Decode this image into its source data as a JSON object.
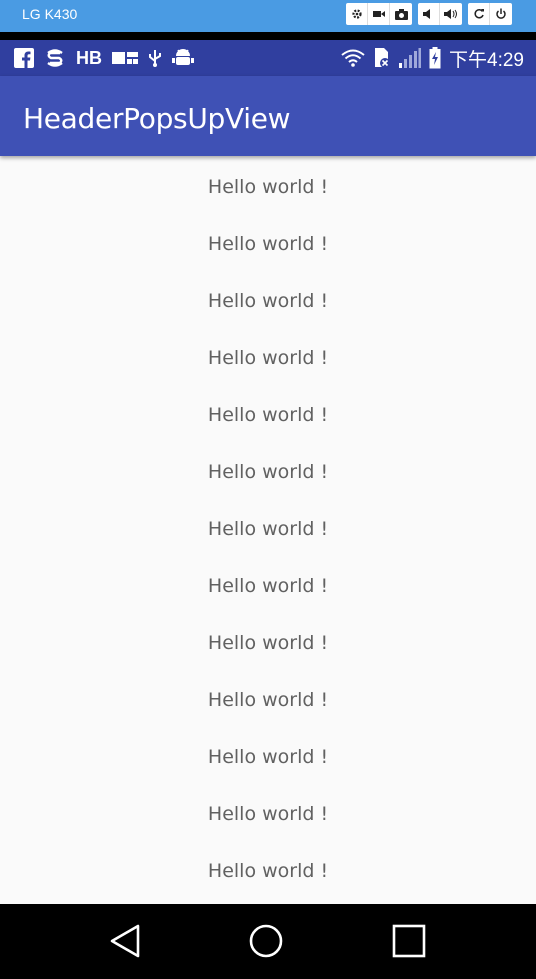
{
  "emulator": {
    "title": "LG K430",
    "controls": [
      {
        "icon": "settings-icon"
      },
      {
        "icon": "video-icon"
      },
      {
        "icon": "camera-icon"
      },
      {
        "icon": "volume-down-icon"
      },
      {
        "icon": "volume-up-icon"
      },
      {
        "icon": "rotate-icon"
      },
      {
        "icon": "power-icon"
      }
    ]
  },
  "status_bar": {
    "left_text": "HB",
    "time": "下午4:29"
  },
  "app_bar": {
    "title": "HeaderPopsUpView",
    "color": "#3f51b5",
    "status_color": "#303f9f"
  },
  "list": {
    "items": [
      "Hello world !",
      "Hello world !",
      "Hello world !",
      "Hello world !",
      "Hello world !",
      "Hello world !",
      "Hello world !",
      "Hello world !",
      "Hello world !",
      "Hello world !",
      "Hello world !",
      "Hello world !",
      "Hello world !"
    ]
  },
  "nav_bar": {
    "buttons": [
      "back-icon",
      "home-icon",
      "recents-icon"
    ]
  }
}
